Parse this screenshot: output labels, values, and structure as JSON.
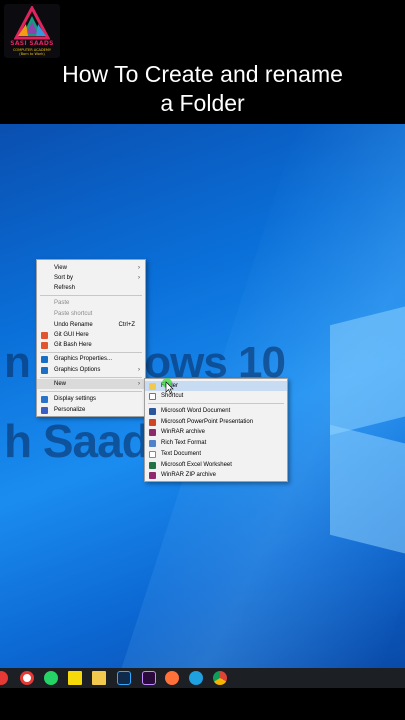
{
  "header": {
    "logo": {
      "name": "SASI SAADS",
      "tagline": "COMPUTER ACADEMY",
      "slogan": "(Born to Work)"
    },
    "title_line1": "How To Create and rename",
    "title_line2": "a Folder"
  },
  "desktop": {
    "watermark_line1": "n Windows 10",
    "watermark_line2": "h Saadi"
  },
  "context_menu": {
    "items": [
      {
        "label": "View",
        "submenu": true
      },
      {
        "label": "Sort by",
        "submenu": true
      },
      {
        "label": "Refresh"
      },
      {
        "label": "Paste",
        "disabled": true
      },
      {
        "label": "Paste shortcut",
        "disabled": true
      },
      {
        "label": "Undo Rename",
        "shortcut": "Ctrl+Z"
      },
      {
        "label": "Git GUI Here",
        "icon": "git-gui-icon"
      },
      {
        "label": "Git Bash Here",
        "icon": "git-bash-icon"
      },
      {
        "label": "Graphics Properties...",
        "icon": "intel-graphics-icon"
      },
      {
        "label": "Graphics Options",
        "icon": "intel-graphics-icon",
        "submenu": true
      },
      {
        "label": "New",
        "submenu": true,
        "highlighted": true
      },
      {
        "label": "Display settings",
        "icon": "display-icon"
      },
      {
        "label": "Personalize",
        "icon": "personalize-icon"
      }
    ]
  },
  "new_submenu": {
    "items": [
      {
        "label": "Folder",
        "icon": "folder-icon",
        "highlighted": true
      },
      {
        "label": "Shortcut",
        "icon": "shortcut-icon"
      },
      {
        "label": "Microsoft Word Document",
        "icon": "word-icon"
      },
      {
        "label": "Microsoft PowerPoint Presentation",
        "icon": "powerpoint-icon"
      },
      {
        "label": "WinRAR archive",
        "icon": "winrar-icon"
      },
      {
        "label": "Rich Text Format",
        "icon": "rtf-icon"
      },
      {
        "label": "Text Document",
        "icon": "text-document-icon"
      },
      {
        "label": "Microsoft Excel Worksheet",
        "icon": "excel-icon"
      },
      {
        "label": "WinRAR ZIP archive",
        "icon": "winrar-zip-icon"
      }
    ]
  },
  "taskbar": {
    "icons": [
      "opera-icon",
      "record-icon",
      "whatsapp-icon",
      "sticky-notes-icon",
      "file-explorer-icon",
      "photoshop-icon",
      "premiere-icon",
      "firefox-icon",
      "edge-icon",
      "chrome-icon"
    ]
  },
  "colors": {
    "desktop_blue": "#0a6fd8",
    "menu_bg": "#f2f2f2",
    "submenu_highlight": "#c7dbf2",
    "taskbar": "#1c1f24"
  }
}
